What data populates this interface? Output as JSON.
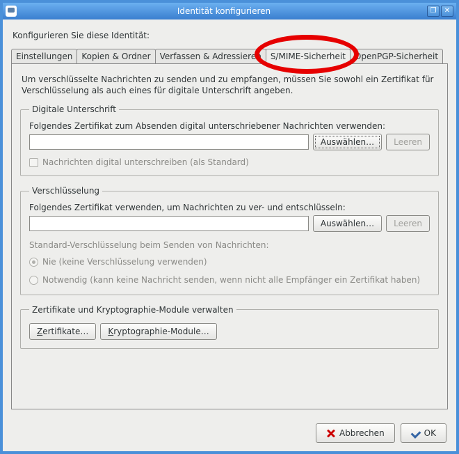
{
  "window": {
    "title": "Identität konfigurieren"
  },
  "instruction": "Konfigurieren Sie diese Identität:",
  "tabs": [
    {
      "label": "Einstellungen"
    },
    {
      "label": "Kopien & Ordner"
    },
    {
      "label": "Verfassen & Adressieren"
    },
    {
      "label": "S/MIME-Sicherheit"
    },
    {
      "label": "OpenPGP-Sicherheit"
    }
  ],
  "panel": {
    "description": "Um verschlüsselte Nachrichten zu senden und zu empfangen, müssen Sie sowohl ein Zertifikat für Verschlüsselung als auch eines für digitale Unterschrift angeben.",
    "signing": {
      "legend": "Digitale Unterschrift",
      "certLabel": "Folgendes Zertifikat zum Absenden digital unterschriebener Nachrichten verwenden:",
      "certValue": "",
      "btnSelect": "Auswählen…",
      "btnClear": "Leeren",
      "signDefault": "Nachrichten digital unterschreiben (als Standard)"
    },
    "encryption": {
      "legend": "Verschlüsselung",
      "certLabel": "Folgendes Zertifikat verwenden, um Nachrichten zu ver- und entschlüsseln:",
      "certValue": "",
      "btnSelect": "Auswählen…",
      "btnClear": "Leeren",
      "defaultLabel": "Standard-Verschlüsselung beim Senden von Nachrichten:",
      "radioNever": "Nie (keine Verschlüsselung verwenden)",
      "radioRequired": "Notwendig (kann keine Nachricht senden, wenn nicht alle Empfänger ein Zertifikat haben)"
    },
    "manage": {
      "legend": "Zertifikate und Kryptographie-Module verwalten",
      "btnCerts": "Zertifikate…",
      "btnCrypto": "Kryptographie-Module…"
    }
  },
  "footer": {
    "cancel": "Abbrechen",
    "ok": "OK"
  },
  "annotation": {
    "highlights_tab_index": 3
  }
}
